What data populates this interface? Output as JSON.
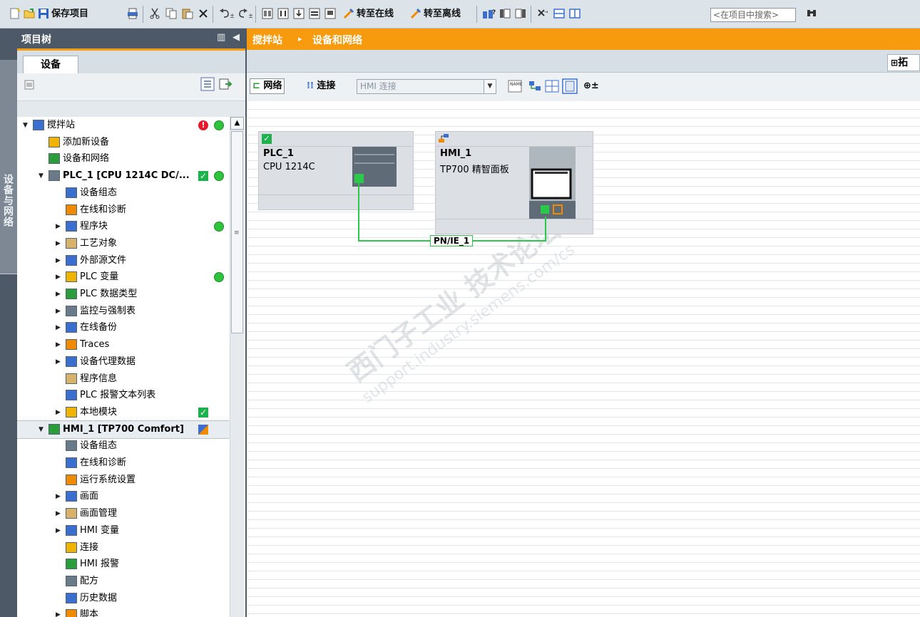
{
  "toolbar": {
    "save_project": "保存项目",
    "go_online": "转至在线",
    "go_offline": "转至离线",
    "search_placeholder": "<在项目中搜索>"
  },
  "side_tab": {
    "label": "设备与网络"
  },
  "project_tree": {
    "title": "项目树",
    "tab": "设备",
    "items": [
      {
        "label": "搅拌站",
        "level": 0,
        "arrow": "down",
        "status": [
          "error",
          "ok"
        ]
      },
      {
        "label": "添加新设备",
        "level": 1,
        "arrow": ""
      },
      {
        "label": "设备和网络",
        "level": 1,
        "arrow": ""
      },
      {
        "label": "PLC_1 [CPU 1214C DC/...",
        "level": 1,
        "arrow": "down",
        "status": [
          "check",
          "ok"
        ]
      },
      {
        "label": "设备组态",
        "level": 2,
        "arrow": ""
      },
      {
        "label": "在线和诊断",
        "level": 2,
        "arrow": ""
      },
      {
        "label": "程序块",
        "level": 2,
        "arrow": "right",
        "status": [
          "ok"
        ]
      },
      {
        "label": "工艺对象",
        "level": 2,
        "arrow": "right"
      },
      {
        "label": "外部源文件",
        "level": 2,
        "arrow": "right"
      },
      {
        "label": "PLC 变量",
        "level": 2,
        "arrow": "right",
        "status": [
          "ok"
        ]
      },
      {
        "label": "PLC 数据类型",
        "level": 2,
        "arrow": "right"
      },
      {
        "label": "监控与强制表",
        "level": 2,
        "arrow": "right"
      },
      {
        "label": "在线备份",
        "level": 2,
        "arrow": "right"
      },
      {
        "label": "Traces",
        "level": 2,
        "arrow": "right"
      },
      {
        "label": "设备代理数据",
        "level": 2,
        "arrow": "right"
      },
      {
        "label": "程序信息",
        "level": 2,
        "arrow": ""
      },
      {
        "label": "PLC 报警文本列表",
        "level": 2,
        "arrow": ""
      },
      {
        "label": "本地模块",
        "level": 2,
        "arrow": "right",
        "status": [
          "check"
        ]
      },
      {
        "label": "HMI_1 [TP700 Comfort]",
        "level": 1,
        "arrow": "down",
        "status": [
          "net"
        ],
        "selected": true
      },
      {
        "label": "设备组态",
        "level": 2,
        "arrow": ""
      },
      {
        "label": "在线和诊断",
        "level": 2,
        "arrow": ""
      },
      {
        "label": "运行系统设置",
        "level": 2,
        "arrow": ""
      },
      {
        "label": "画面",
        "level": 2,
        "arrow": "right"
      },
      {
        "label": "画面管理",
        "level": 2,
        "arrow": "right"
      },
      {
        "label": "HMI 变量",
        "level": 2,
        "arrow": "right"
      },
      {
        "label": "连接",
        "level": 2,
        "arrow": ""
      },
      {
        "label": "HMI 报警",
        "level": 2,
        "arrow": ""
      },
      {
        "label": "配方",
        "level": 2,
        "arrow": ""
      },
      {
        "label": "历史数据",
        "level": 2,
        "arrow": ""
      },
      {
        "label": "脚本",
        "level": 2,
        "arrow": "right"
      }
    ]
  },
  "editor": {
    "breadcrumb_root": "搅拌站",
    "breadcrumb_sep": "▸",
    "breadcrumb_page": "设备和网络",
    "topology_tab": "拓",
    "network_btn": "网络",
    "connections_btn": "连接",
    "connection_type": "HMI 连接"
  },
  "devices": {
    "plc": {
      "name": "PLC_1",
      "type": "CPU 1214C"
    },
    "hmi": {
      "name": "HMI_1",
      "type": "TP700 精智面板"
    }
  },
  "network": {
    "label": "PN/IE_1",
    "color": "#2cc84a"
  },
  "watermark": {
    "main": "西门子工业 技术论坛",
    "sub": "support.industry.siemens.com/cs"
  },
  "colors": {
    "accent": "#f79a0d",
    "panel_dark": "#4d5966",
    "ok_green": "#2fc23b",
    "error_red": "#e8182a"
  }
}
